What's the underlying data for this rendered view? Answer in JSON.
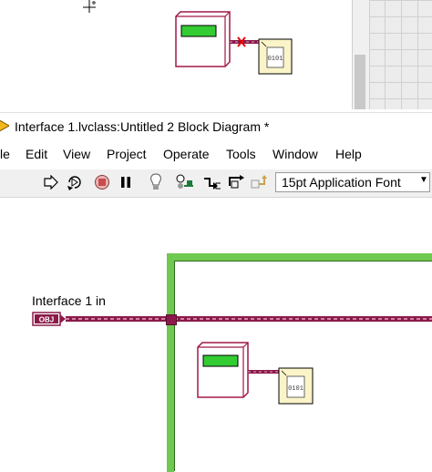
{
  "window": {
    "title": "Interface 1.lvclass:Untitled 2 Block Diagram *"
  },
  "menu": {
    "items": [
      "le",
      "Edit",
      "View",
      "Project",
      "Operate",
      "Tools",
      "Window",
      "Help"
    ]
  },
  "toolbar": {
    "tools": [
      "run-arrow-icon",
      "run-continuously-icon",
      "abort-icon",
      "pause-icon",
      "highlight-execution-icon",
      "retain-wire-values-icon",
      "step-into-icon",
      "step-over-icon",
      "step-out-icon"
    ],
    "font": {
      "value": "15pt Application Font"
    }
  },
  "diagram": {
    "terminal": {
      "label": "Interface 1 in",
      "type_text": "OBJ"
    },
    "colors": {
      "wire": "#8b1a4a",
      "loop_border": "#6fc84f",
      "node_fill": "#33cc33"
    }
  }
}
